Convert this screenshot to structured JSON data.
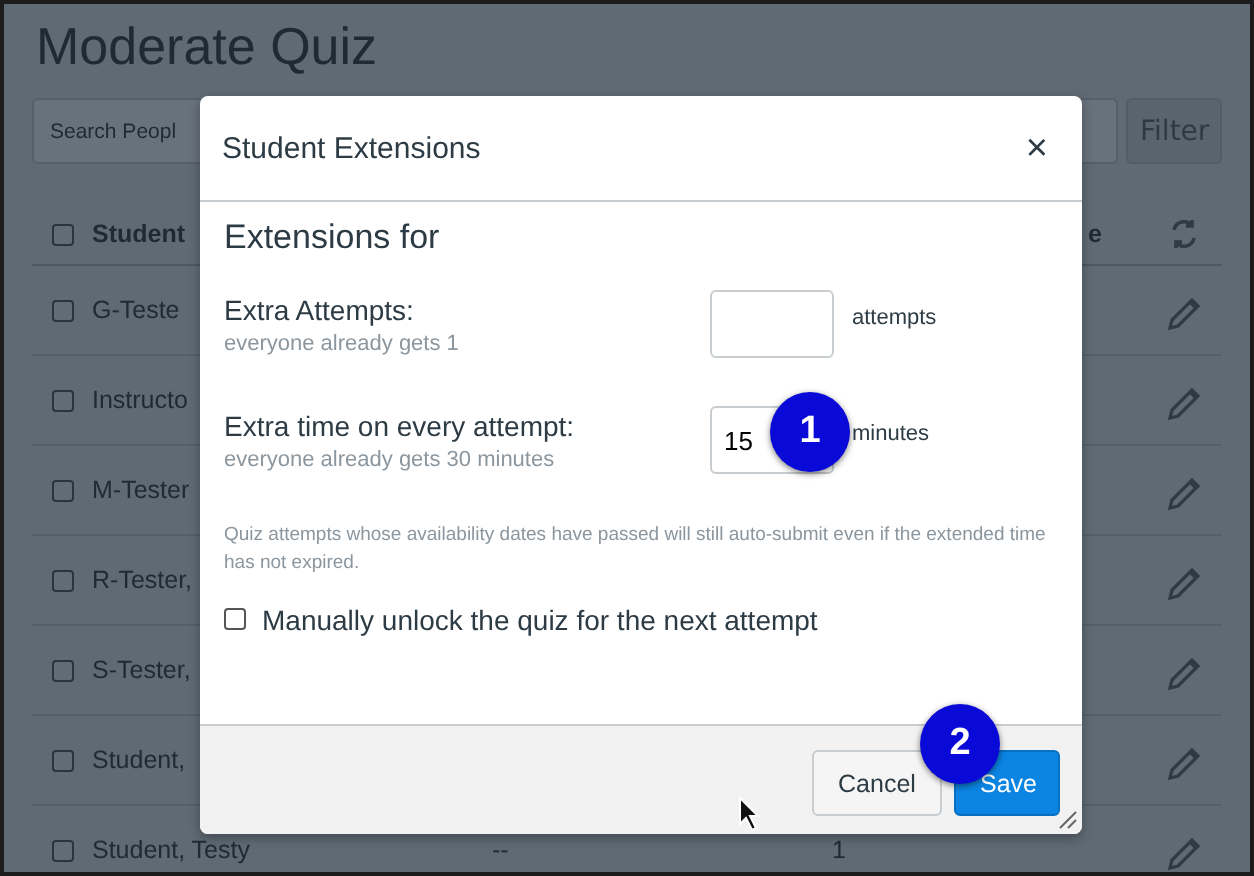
{
  "page": {
    "title": "Moderate Quiz",
    "search": {
      "placeholder": "Search Peopl"
    },
    "filter_button": "Filter"
  },
  "table": {
    "select_all": {
      "checked": false
    },
    "columns": [
      "Student",
      "e"
    ],
    "rows": [
      {
        "student": "G-Teste",
        "checked": false
      },
      {
        "student": "Instructo",
        "checked": false
      },
      {
        "student": "M-Tester",
        "checked": false
      },
      {
        "student": "R-Tester,",
        "checked": false
      },
      {
        "student": "S-Tester,",
        "checked": false
      },
      {
        "student": "Student,",
        "checked": false
      },
      {
        "student": "Student, Testy",
        "column_2": "--",
        "column_3": "1",
        "checked": false
      }
    ]
  },
  "dialog": {
    "title": "Student Extensions",
    "close": "×",
    "heading": "Extensions for",
    "fields": [
      {
        "label": "Extra Attempts:",
        "hint": "everyone already gets 1",
        "unit": "attempts"
      },
      {
        "label": "Extra time on every attempt:",
        "hint": "everyone already gets 30 minutes",
        "value": "15",
        "unit": "minutes"
      }
    ],
    "note": "Quiz attempts whose availability dates have passed will still auto-submit even if the extended time has not expired.",
    "unlock": {
      "label": "Manually unlock the quiz for the next attempt",
      "checked": false
    },
    "buttons": [
      {
        "label": "Cancel",
        "kind": "secondary"
      },
      {
        "label": "Save",
        "kind": "primary"
      }
    ]
  },
  "callouts": [
    "1",
    "2"
  ]
}
